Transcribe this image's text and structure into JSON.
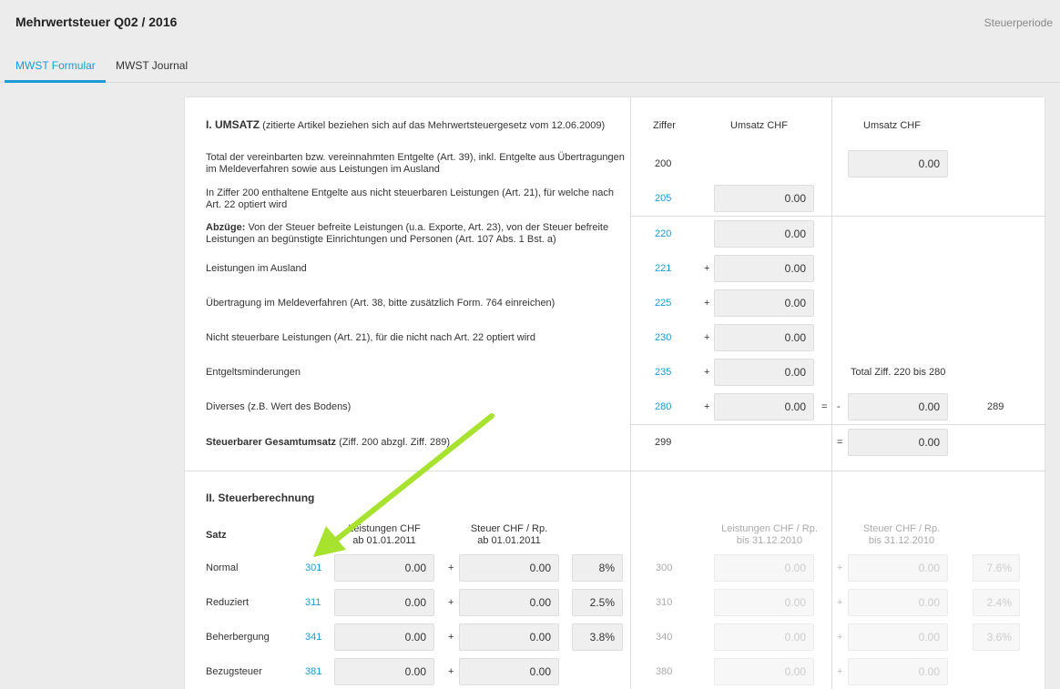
{
  "app": {
    "title": "Mehrwertsteuer Q02 / 2016",
    "period_label": "Steuerperiode"
  },
  "tabs": [
    {
      "label": "MWST Formular",
      "active": true
    },
    {
      "label": "MWST Journal",
      "active": false
    }
  ],
  "colors": {
    "accent": "#1b9ad6",
    "arrow": "#a6e22e"
  },
  "umsatz": {
    "heading": "I. UMSATZ",
    "heading_note": "(zitierte Artikel beziehen sich auf das Mehrwertsteuergesetz vom 12.06.2009)",
    "col_ziffer": "Ziffer",
    "col_umsatz1": "Umsatz CHF",
    "col_umsatz2": "Umsatz CHF",
    "rows": [
      {
        "label": "Total der vereinbarten bzw. vereinnahmten Entgelte (Art. 39), inkl. Entgelte aus Übertragungen im Meldeverfahren sowie aus Leistungen im Ausland",
        "ziffer": "200",
        "value": "0.00"
      },
      {
        "label": "In Ziffer 200 enthaltene Entgelte aus nicht steuerbaren Leistungen (Art. 21), für welche nach Art. 22 optiert wird",
        "ziffer": "205",
        "value": "0.00"
      },
      {
        "label_bold": "Abzüge:",
        "label": " Von der Steuer befreite Leistungen (u.a. Exporte, Art. 23), von der Steuer befreite Leistungen an begünstigte Einrichtungen und Personen (Art. 107 Abs. 1 Bst. a)",
        "ziffer": "220",
        "value": "0.00"
      },
      {
        "label": "Leistungen im Ausland",
        "ziffer": "221",
        "op": "+",
        "value": "0.00"
      },
      {
        "label": "Übertragung im Meldeverfahren (Art. 38, bitte zusätzlich Form. 764 einreichen)",
        "ziffer": "225",
        "op": "+",
        "value": "0.00"
      },
      {
        "label": "Nicht steuerbare Leistungen (Art. 21), für die nicht nach Art. 22 optiert wird",
        "ziffer": "230",
        "op": "+",
        "value": "0.00"
      },
      {
        "label": "Entgeltsminderungen",
        "ziffer": "235",
        "op": "+",
        "value": "0.00"
      },
      {
        "label": "Diverses (z.B. Wert des Bodens)",
        "ziffer": "280",
        "op": "+",
        "value": "0.00"
      }
    ],
    "total_label": "Total Ziff. 220 bis 280",
    "total_eq": "=",
    "total_minus": "-",
    "total_value": "0.00",
    "total_ziffer": "289",
    "gesamt_label_bold": "Steuerbarer Gesamtumsatz",
    "gesamt_label": " (Ziff. 200 abzgl. Ziff. 289)",
    "gesamt_ziffer": "299",
    "gesamt_eq": "=",
    "gesamt_value": "0.00"
  },
  "steuer": {
    "heading": "II. Steuerberechnung",
    "col_satz": "Satz",
    "col_leistungen_new": [
      "Leistungen CHF",
      "ab 01.01.2011"
    ],
    "col_steuer_new": [
      "Steuer CHF / Rp.",
      "ab 01.01.2011"
    ],
    "col_leistungen_old": [
      "Leistungen CHF / Rp.",
      "bis 31.12.2010"
    ],
    "col_steuer_old": [
      "Steuer CHF / Rp.",
      "bis 31.12.2010"
    ],
    "rows": [
      {
        "label": "Normal",
        "ziffer": "301",
        "leistungen": "0.00",
        "op": "+",
        "steuer": "0.00",
        "rate": "8%",
        "old_ziffer": "300",
        "old_leistungen": "0.00",
        "old_op": "+",
        "old_steuer": "0.00",
        "old_rate": "7.6%"
      },
      {
        "label": "Reduziert",
        "ziffer": "311",
        "leistungen": "0.00",
        "op": "+",
        "steuer": "0.00",
        "rate": "2.5%",
        "old_ziffer": "310",
        "old_leistungen": "0.00",
        "old_op": "+",
        "old_steuer": "0.00",
        "old_rate": "2.4%"
      },
      {
        "label": "Beherbergung",
        "ziffer": "341",
        "leistungen": "0.00",
        "op": "+",
        "steuer": "0.00",
        "rate": "3.8%",
        "old_ziffer": "340",
        "old_leistungen": "0.00",
        "old_op": "+",
        "old_steuer": "0.00",
        "old_rate": "3.6%"
      },
      {
        "label": "Bezugsteuer",
        "ziffer": "381",
        "leistungen": "0.00",
        "op": "+",
        "steuer": "0.00",
        "old_ziffer": "380",
        "old_leistungen": "0.00",
        "old_op": "+",
        "old_steuer": "0.00"
      }
    ]
  }
}
